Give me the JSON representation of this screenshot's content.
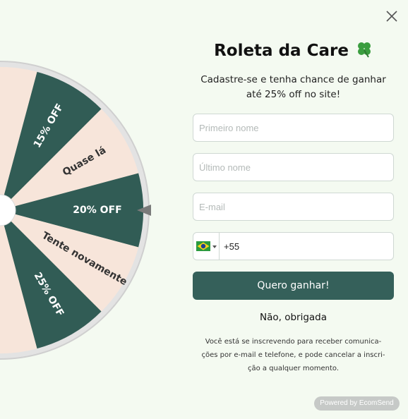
{
  "close": {
    "icon": "close-icon"
  },
  "wheel": {
    "segments": [
      {
        "label": "15% OFF",
        "fill": "#315c55",
        "text_color": "#ffffff"
      },
      {
        "label": "Quase lá",
        "fill": "#f7e5da",
        "text_color": "#333333"
      },
      {
        "label": "20% OFF",
        "fill": "#315c55",
        "text_color": "#ffffff"
      },
      {
        "label": "Tente novamente",
        "fill": "#f7e5da",
        "text_color": "#333333"
      },
      {
        "label": "25% OFF",
        "fill": "#315c55",
        "text_color": "#ffffff"
      }
    ],
    "pointer_icon": "pointer-arrow-icon"
  },
  "form": {
    "title": "Roleta da Care",
    "title_icon": "four-leaf-clover-icon",
    "subtitle_line1": "Cadastre-se e tenha chance de ganhar",
    "subtitle_line2": "até 25% off no site!",
    "first_name_placeholder": "Primeiro nome",
    "last_name_placeholder": "Último nome",
    "email_placeholder": "E-mail",
    "phone": {
      "country_flag": "brazil-flag-icon",
      "value": "+55"
    },
    "submit_label": "Quero ganhar!",
    "decline_label": "Não, obrigada",
    "disclaimer_line1": "Você está se inscrevendo para receber comunica-",
    "disclaimer_line2": "ções por e-mail e telefone, e pode cancelar a inscri-",
    "disclaimer_line3": "ção a qualquer momento."
  },
  "footer": {
    "powered_by": "Powered by EcomSend"
  },
  "colors": {
    "accent": "#35605a",
    "background": "#f4faf1",
    "segment_light": "#f7e5da"
  }
}
